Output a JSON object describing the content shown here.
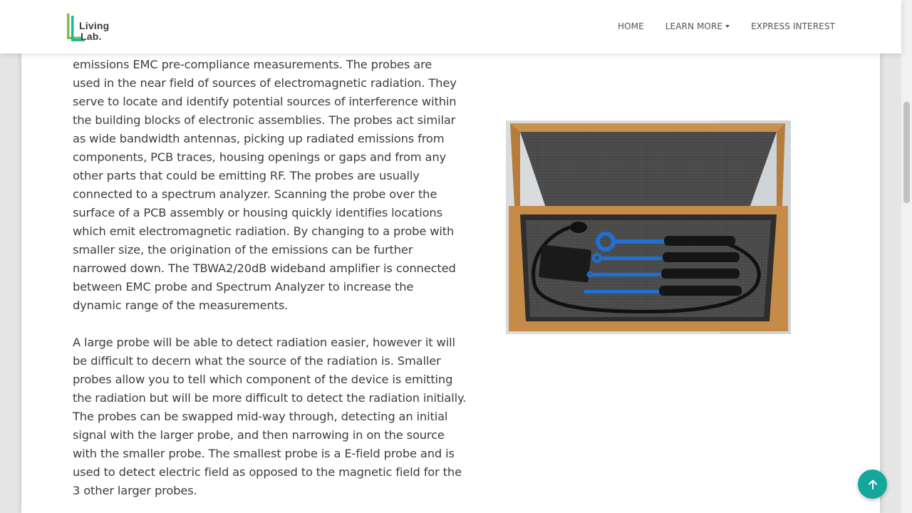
{
  "header": {
    "logo_text_line1": "Living",
    "logo_text_line2": "Lab.",
    "nav": {
      "home": "HOME",
      "learn_more": "LEARN MORE",
      "express_interest": "EXPRESS INTEREST"
    }
  },
  "content": {
    "paragraph1_lines": [
      "emissions EMC pre-compliance measurements. The probes are",
      "used in the near field of sources of electromagnetic radiation. They",
      "serve to locate and identify potential sources of interference within",
      "the building blocks of electronic assemblies. The probes act similar",
      "as wide bandwidth antennas, picking up radiated emissions from",
      "components, PCB traces, housing openings or gaps and from any",
      "other parts that could be emitting RF. The probes are usually",
      "connected to a spectrum analyzer. Scanning the probe over the",
      "surface of a PCB assembly or housing quickly identifies locations",
      "which emit electromagnetic radiation. By changing to a probe with",
      "smaller size, the origination of the emissions can be further",
      "narrowed down. The TBWA2/20dB wideband amplifier is connected",
      "between EMC probe and Spectrum Analyzer to increase the",
      "dynamic range of the measurements."
    ],
    "paragraph2_lines": [
      "A large probe will be able to detect radiation easier, however it will",
      "be difficult to decern what the source of the radiation is. Smaller",
      "probes allow you to tell which component of the device is emitting",
      "the radiation but will be more difficult to detect the radiation initially.",
      "The probes can be swapped mid-way through, detecting an initial",
      "signal with the larger probe, and then narrowing in on the source",
      "with the smaller probe. The smallest probe is a E-field probe and is",
      "used to detect electric field as opposed to the magnetic field for the",
      "3 other larger probes."
    ]
  },
  "colors": {
    "accent": "#12a79a",
    "logo_green": "#7ac143",
    "logo_teal": "#1fb5a8",
    "probe_blue": "#1e6fd6"
  },
  "icons": {
    "back_to_top": "arrow-up-icon",
    "dropdown": "caret-down-icon"
  }
}
